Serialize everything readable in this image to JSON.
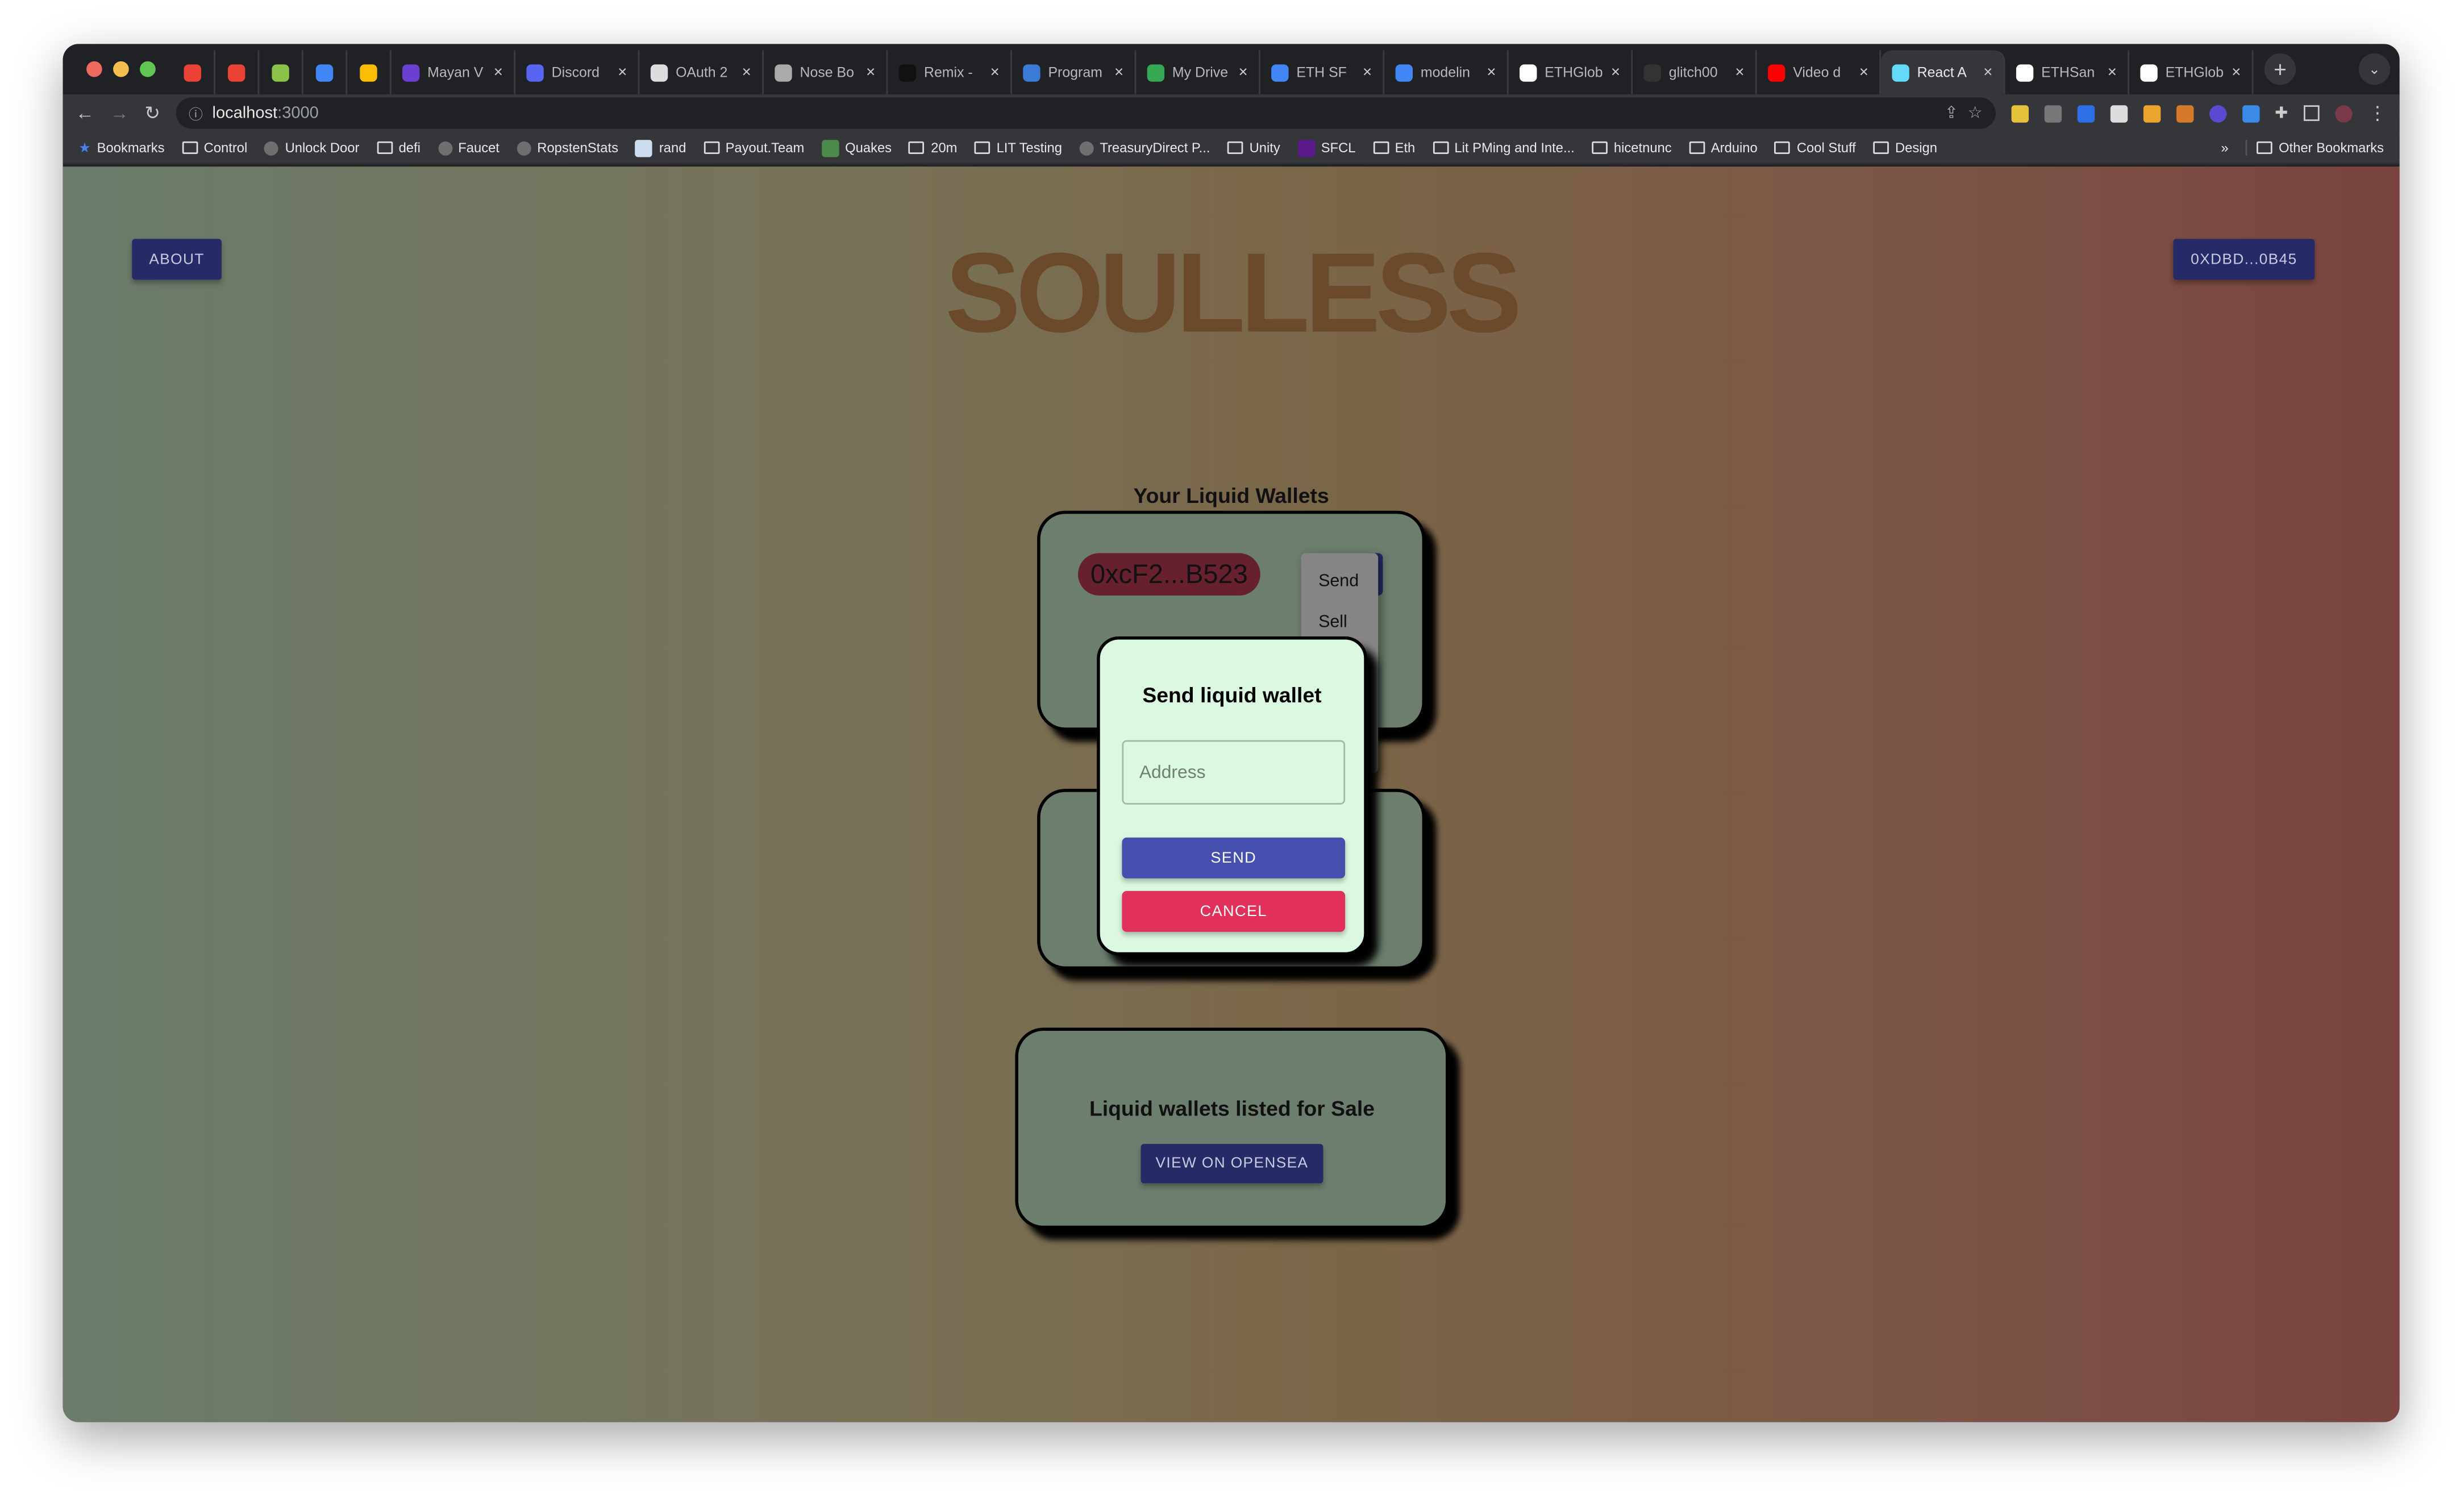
{
  "browser": {
    "tabs": [
      {
        "label": "",
        "icon": "gmail-icon",
        "pinned": true
      },
      {
        "label": "",
        "icon": "gmail-icon",
        "pinned": true
      },
      {
        "label": "",
        "icon": "app-icon",
        "pinned": true
      },
      {
        "label": "",
        "icon": "calendar-icon",
        "pinned": true
      },
      {
        "label": "",
        "icon": "keep-icon",
        "pinned": true
      },
      {
        "label": "Mayan V",
        "icon": "mayan-icon"
      },
      {
        "label": "Discord",
        "icon": "discord-icon"
      },
      {
        "label": "OAuth 2",
        "icon": "oauth-icon"
      },
      {
        "label": "Nose Bo",
        "icon": "nose-icon"
      },
      {
        "label": "Remix -",
        "icon": "remix-icon"
      },
      {
        "label": "Program",
        "icon": "program-icon"
      },
      {
        "label": "My Drive",
        "icon": "drive-icon"
      },
      {
        "label": "ETH SF",
        "icon": "docs-icon"
      },
      {
        "label": "modelin",
        "icon": "docs-icon"
      },
      {
        "label": "ETHGlob",
        "icon": "ethglobal-icon"
      },
      {
        "label": "glitch00",
        "icon": "github-icon"
      },
      {
        "label": "Video d",
        "icon": "youtube-icon"
      },
      {
        "label": "React A",
        "icon": "react-icon",
        "active": true
      },
      {
        "label": "ETHSan",
        "icon": "ethglobal-icon"
      },
      {
        "label": "ETHGlob",
        "icon": "ethglobal-icon"
      }
    ],
    "url_host": "localhost",
    "url_port": ":3000",
    "bookmarks": [
      "Bookmarks",
      "Control",
      "Unlock Door",
      "defi",
      "Faucet",
      "RopstenStats",
      "rand",
      "Payout.Team",
      "Quakes",
      "20m",
      "LIT Testing",
      "TreasuryDirect P...",
      "Unity",
      "SFCL",
      "Eth",
      "Lit PMing and Inte...",
      "hicetnunc",
      "Arduino",
      "Cool Stuff",
      "Design"
    ],
    "bookmarks_overflow": "»",
    "other_bookmarks": "Other Bookmarks"
  },
  "app": {
    "about_label": "ABOUT",
    "account_label": "0XDBD...0B45",
    "title": "SOULLESS",
    "wallets_heading": "Your Liquid Wallets",
    "wallet_address": "0xcF2...B523",
    "menu": [
      "Send",
      "Sell"
    ],
    "sale_heading": "Liquid wallets listed for Sale",
    "opensea_label": "VIEW ON OPENSEA"
  },
  "dialog": {
    "title": "Send liquid wallet",
    "address_placeholder": "Address",
    "send_label": "SEND",
    "cancel_label": "CANCEL"
  },
  "colors": {
    "primary": "#454fae",
    "danger": "#e1305a",
    "nav": "#262a66",
    "dialog_bg": "#dbf8e0",
    "wallet_pill": "#67202e"
  }
}
